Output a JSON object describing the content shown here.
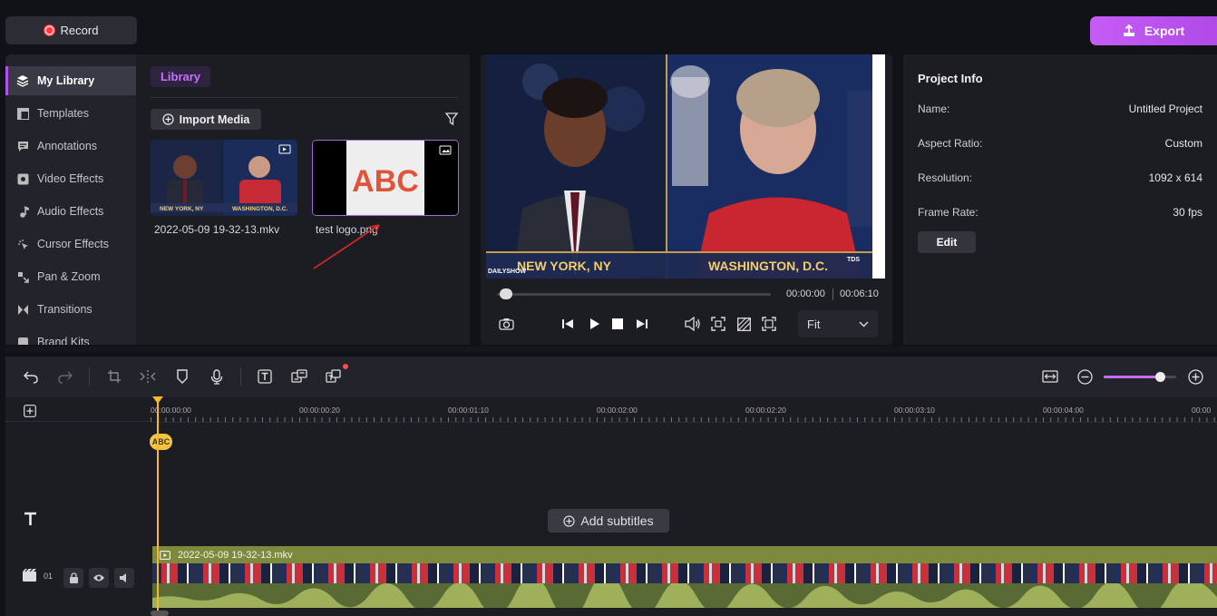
{
  "top": {
    "record_label": "Record",
    "export_label": "Export"
  },
  "nav": {
    "items": [
      {
        "label": "My Library",
        "icon": "layers-icon"
      },
      {
        "label": "Templates",
        "icon": "templates-icon"
      },
      {
        "label": "Annotations",
        "icon": "annotation-icon"
      },
      {
        "label": "Video Effects",
        "icon": "video-effects-icon"
      },
      {
        "label": "Audio Effects",
        "icon": "music-note-icon"
      },
      {
        "label": "Cursor Effects",
        "icon": "cursor-icon"
      },
      {
        "label": "Pan & Zoom",
        "icon": "pan-zoom-icon"
      },
      {
        "label": "Transitions",
        "icon": "transitions-icon"
      },
      {
        "label": "Brand Kits",
        "icon": "brand-kits-icon"
      }
    ]
  },
  "library": {
    "tab_label": "Library",
    "import_label": "Import Media",
    "items": [
      {
        "name": "2022-05-09 19-32-13.mkv",
        "type": "video"
      },
      {
        "name": "test logo.png",
        "type": "image"
      }
    ],
    "logo_text": "ABC"
  },
  "preview": {
    "banner_left": "NEW YORK, NY",
    "banner_right": "WASHINGTON, D.C.",
    "show_logo": "DAILYSHOW",
    "channel_tag": "TDS",
    "current_time": "00:00:00",
    "total_time": "00:06:10",
    "progress": 0.02,
    "fit_label": "Fit"
  },
  "project_info": {
    "title": "Project Info",
    "rows": [
      {
        "label": "Name:",
        "value": "Untitled Project"
      },
      {
        "label": "Aspect Ratio:",
        "value": "Custom"
      },
      {
        "label": "Resolution:",
        "value": "1092 x 614"
      },
      {
        "label": "Frame Rate:",
        "value": "30 fps"
      }
    ],
    "edit_label": "Edit"
  },
  "timeline": {
    "ruler": [
      "00:00:00:00",
      "00:00:00:20",
      "00:00:01:10",
      "00:00:02:00",
      "00:00:02:20",
      "00:00:03:10",
      "00:00:04:00",
      "00:00"
    ],
    "marker_label": "ABC",
    "add_subtitles_label": "Add subtitles",
    "clip_name": "2022-05-09 19-32-13.mkv",
    "track_number": "01",
    "zoom_level": 0.78
  },
  "colors": {
    "accent": "#b452f0",
    "playhead": "#f5b82e",
    "clip": "#7d8a3e"
  }
}
